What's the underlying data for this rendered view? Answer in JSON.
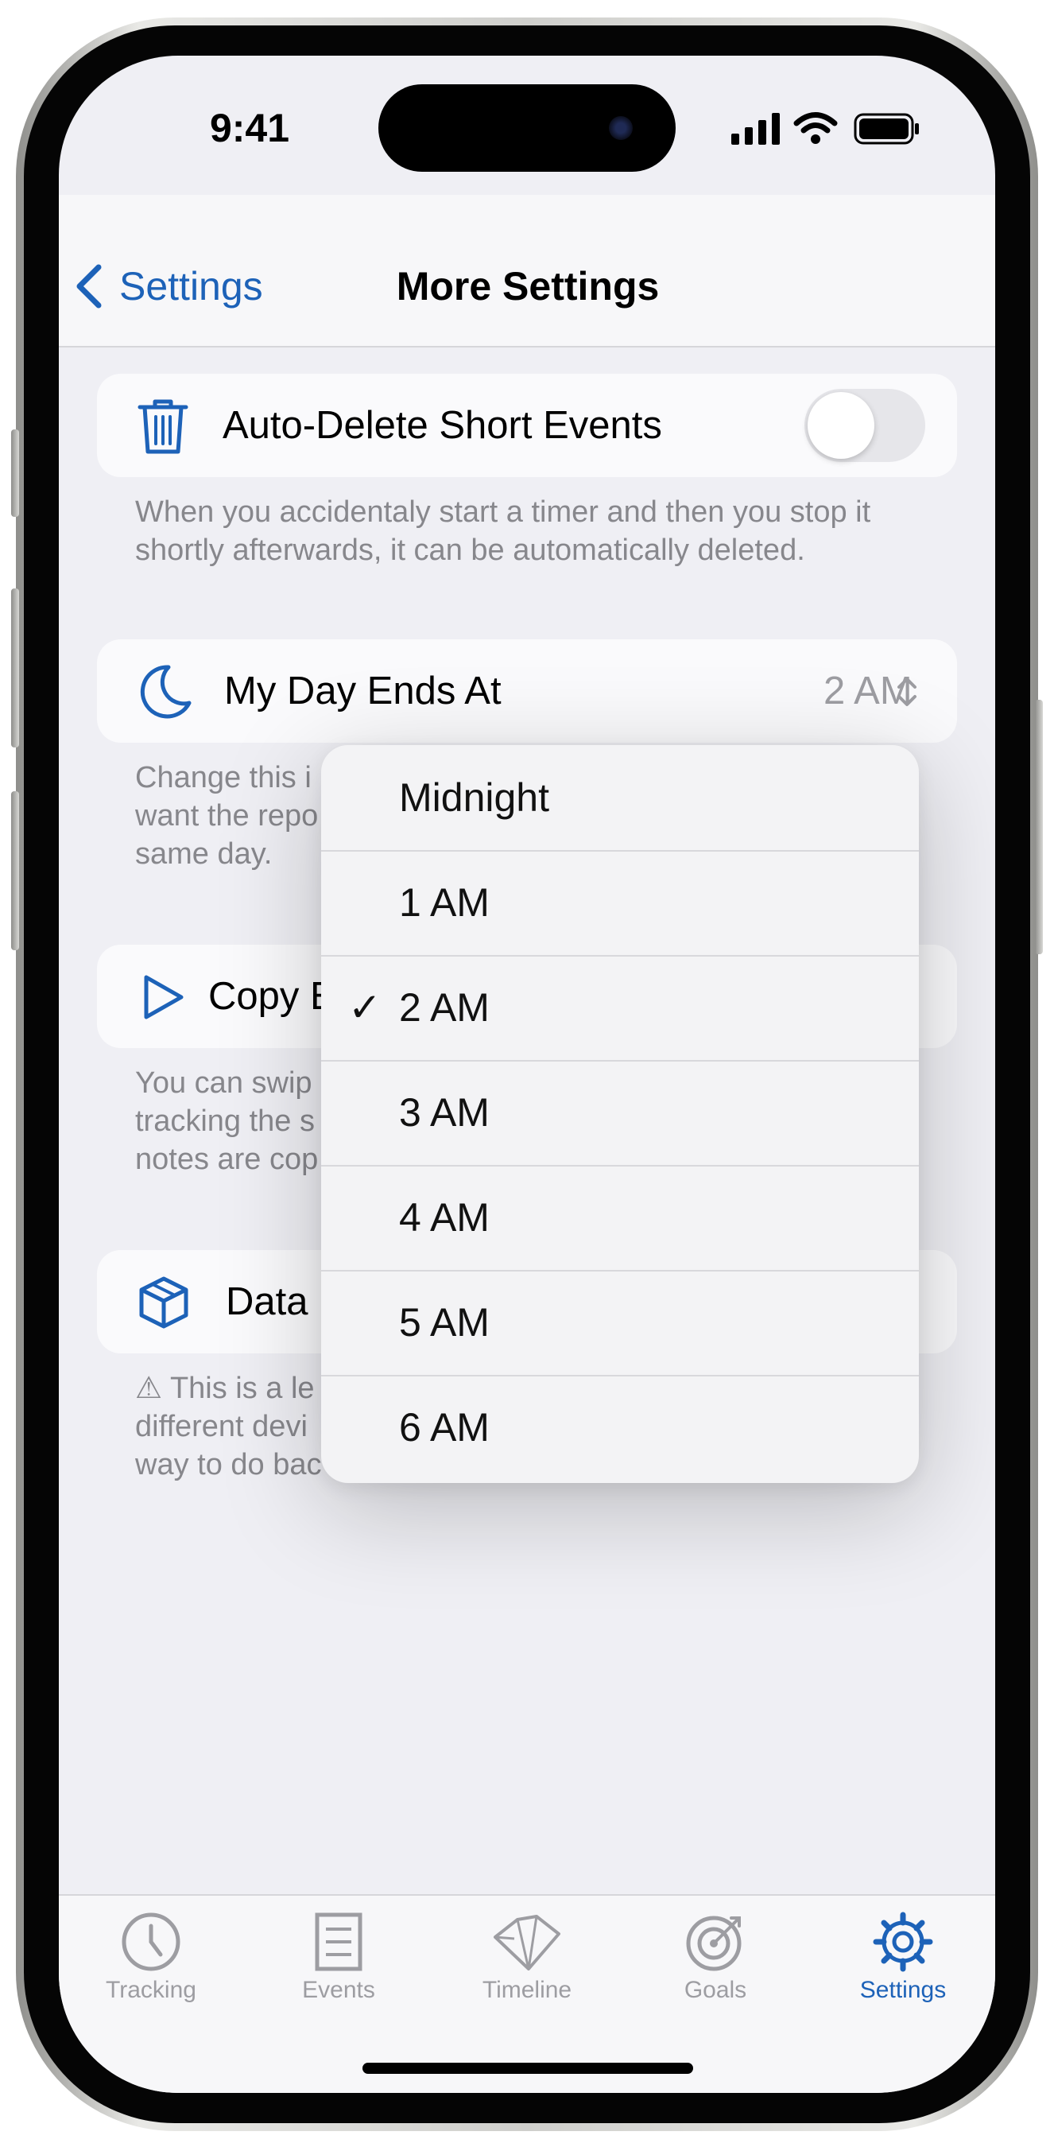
{
  "status_bar": {
    "time": "9:41"
  },
  "nav": {
    "back_label": "Settings",
    "title": "More Settings"
  },
  "auto_delete": {
    "label": "Auto-Delete Short Events",
    "enabled": false,
    "footer": "When you accidentaly start a timer and then you stop it shortly afterwards, it can be automatically deleted."
  },
  "day_ends": {
    "label": "My Day Ends At",
    "value": "2 AM",
    "footer_fragments": [
      "Change this i",
      "want the repo",
      "same day."
    ]
  },
  "copy_row": {
    "label_fragment": "Copy E",
    "footer_fragments": [
      "You can swip",
      "tracking the s",
      "notes are cop"
    ]
  },
  "data_row": {
    "label_fragment": "Data",
    "footer_fragments": [
      "⚠ This is a le",
      "different devi",
      "way to do bac"
    ]
  },
  "menu": {
    "items": [
      "Midnight",
      "1 AM",
      "2 AM",
      "3 AM",
      "4 AM",
      "5 AM",
      "6 AM"
    ],
    "selected": "2 AM",
    "check_glyph": "✓"
  },
  "tabbar": {
    "items": [
      {
        "label": "Tracking",
        "icon": "clock-icon"
      },
      {
        "label": "Events",
        "icon": "document-icon"
      },
      {
        "label": "Timeline",
        "icon": "timeline-icon"
      },
      {
        "label": "Goals",
        "icon": "target-icon"
      },
      {
        "label": "Settings",
        "icon": "gear-icon"
      }
    ],
    "active": "Settings"
  },
  "colors": {
    "accent": "#1d62b8",
    "secondary_text": "#87878c",
    "background": "#efeff4"
  }
}
